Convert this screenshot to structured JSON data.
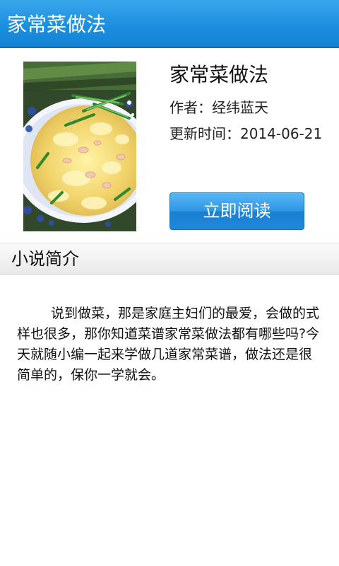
{
  "header": {
    "title": "家常菜做法"
  },
  "book": {
    "cover_image": "stir-fried-egg-with-shrimp-photo",
    "title": "家常菜做法",
    "author": "作者：经纬蓝天",
    "updated": "更新时间：2014-06-21",
    "read_button_label": "立即阅读"
  },
  "section": {
    "label": "小说简介"
  },
  "description": {
    "text": "说到做菜，那是家庭主妇们的最爱，会做的式样也很多，那你知道菜谱家常菜做法都有哪些吗?今天就随小编一起来学做几道家常菜谱，做法还是很简单的，保你一学就会。"
  },
  "colors": {
    "header_blue": "#1d8fdf",
    "button_blue": "#2e95e4",
    "header_text": "#ffffff"
  }
}
